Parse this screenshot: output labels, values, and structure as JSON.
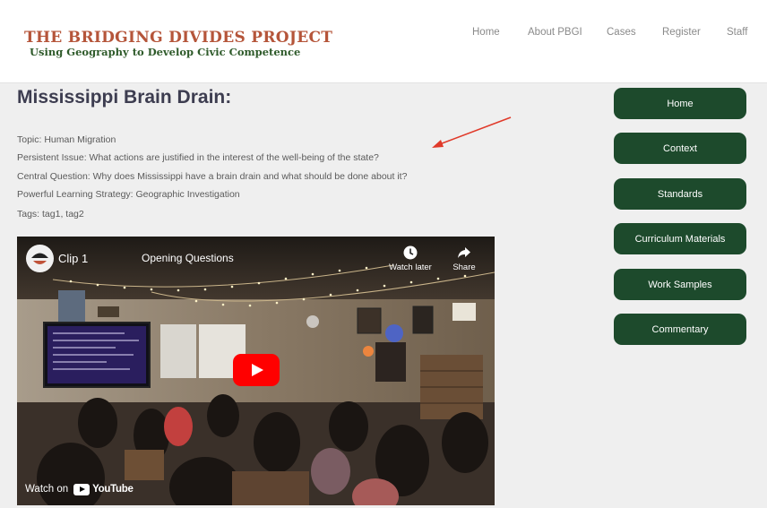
{
  "header": {
    "logo_title": "THE BRIDGING DIVIDES PROJECT",
    "logo_subtitle": "Using Geography to Develop Civic Competence",
    "nav": [
      "Home",
      "About PBGI",
      "Cases",
      "Register",
      "Staff"
    ]
  },
  "main": {
    "title": "Mississippi Brain Drain:",
    "meta": [
      "Topic: Human Migration",
      "Persistent Issue: What actions are justified in the interest of the well-being of the state?",
      "Central Question: Why does Mississippi have a brain drain and what should be done about it?",
      "Powerful Learning Strategy: Geographic Investigation",
      "Tags: tag1, tag2"
    ]
  },
  "video": {
    "channel_title": "Clip 1",
    "video_title": "Opening Questions",
    "watch_later_label": "Watch later",
    "share_label": "Share",
    "watch_on_label": "Watch on",
    "youtube_label": "YouTube"
  },
  "sidebar": {
    "buttons": [
      "Home",
      "Context",
      "Standards",
      "Curriculum Materials",
      "Work Samples",
      "Commentary"
    ]
  },
  "colors": {
    "logo_title": "#b5553a",
    "logo_subtitle": "#2e5a2a",
    "sidebar_button": "#1d4a2c",
    "arrow": "#e03a2a",
    "youtube_red": "#ff0000"
  },
  "icons": [
    "clock-icon",
    "share-arrow-icon",
    "youtube-play-icon",
    "red-annotation-arrow-icon"
  ]
}
